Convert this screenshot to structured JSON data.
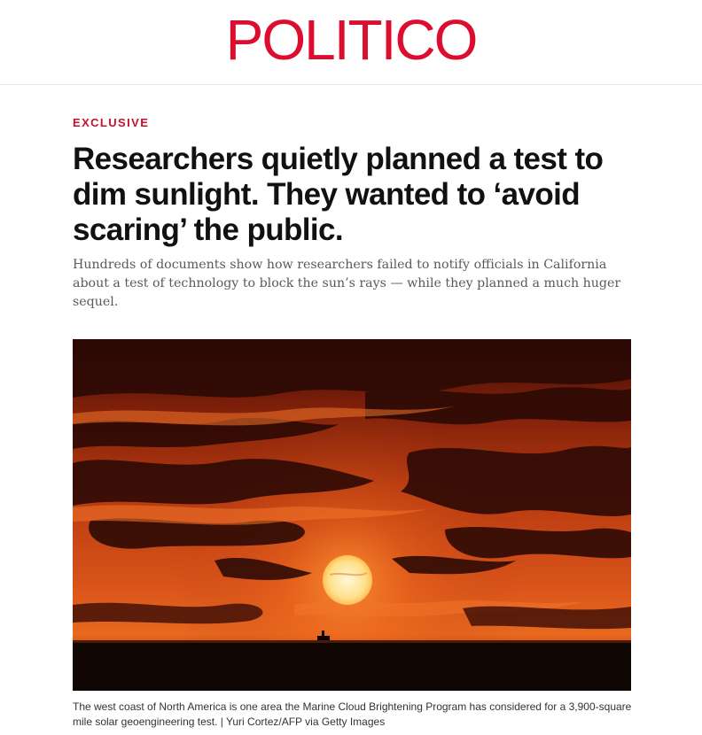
{
  "masthead": {
    "logo_text": "POLITICO",
    "brand_color": "#dc0d2f"
  },
  "article": {
    "kicker": "EXCLUSIVE",
    "headline": "Researchers quietly planned a test to dim sunlight. They wanted to ‘avoid scaring’ the public.",
    "dek": "Hundreds of documents show how researchers failed to notify officials in California about a test of technology to block the sun’s rays — while they planned a much huger sequel."
  },
  "hero_image": {
    "caption": "The west coast of North America is one area the Marine Cloud Brightening Program has considered for a 3,900-square mile solar geoengineering test.",
    "credit": "Yuri Cortez/AFP via Getty Images",
    "credit_separator": " | "
  },
  "colors": {
    "kicker": "#c8102e",
    "headline": "#111111",
    "dek": "#5a5a5a"
  }
}
